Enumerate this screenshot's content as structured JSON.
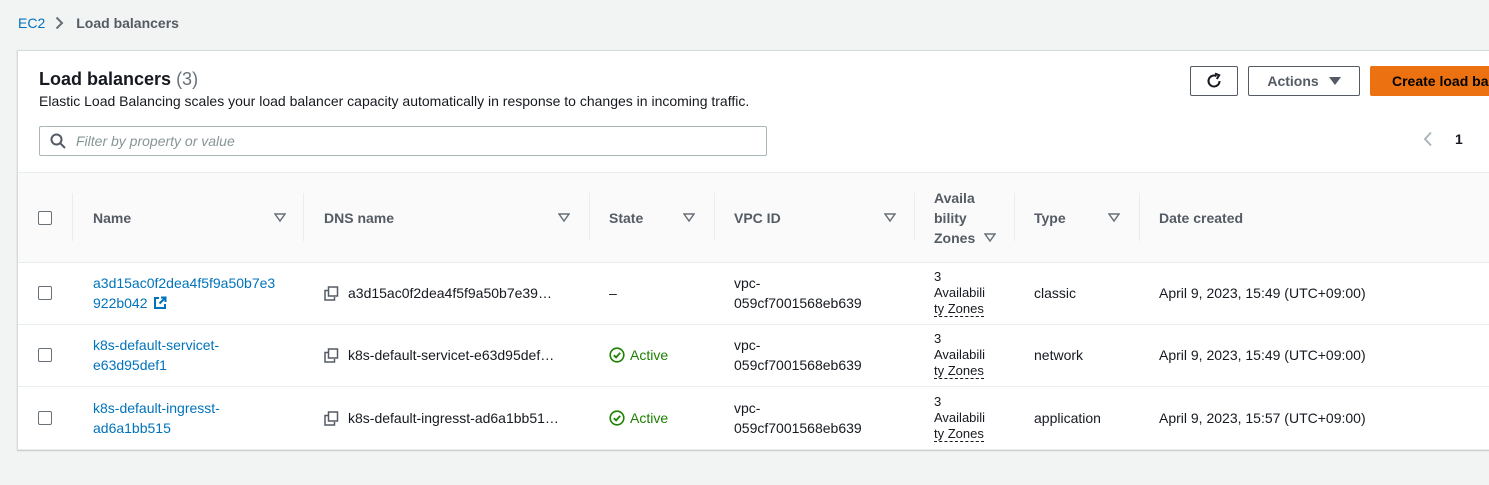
{
  "breadcrumb": {
    "root": "EC2",
    "current": "Load balancers"
  },
  "panel": {
    "title": "Load balancers",
    "count": "(3)",
    "description": "Elastic Load Balancing scales your load balancer capacity automatically in response to changes in incoming traffic.",
    "actions_label": "Actions",
    "create_label": "Create load ba",
    "filter_placeholder": "Filter by property or value",
    "page": "1"
  },
  "columns": {
    "name": "Name",
    "dns": "DNS name",
    "state": "State",
    "vpc": "VPC ID",
    "az1": "Availa",
    "az2": "bility",
    "az3": "Zones",
    "type": "Type",
    "date": "Date created"
  },
  "rows": [
    {
      "name1": "a3d15ac0f2dea4f5f9a50b7e3",
      "name2": "922b042",
      "dns": "a3d15ac0f2dea4f5f9a50b7e39…",
      "state": "–",
      "vpc1": "vpc-",
      "vpc2": "059cf7001568eb639",
      "az1": "3",
      "az2": "Availabili",
      "az3": "ty Zones",
      "type": "classic",
      "date": "April 9, 2023, 15:49 (UTC+09:00)"
    },
    {
      "name1": "k8s-default-servicet-",
      "name2": "e63d95def1",
      "dns": "k8s-default-servicet-e63d95def…",
      "state": "Active",
      "vpc1": "vpc-",
      "vpc2": "059cf7001568eb639",
      "az1": "3",
      "az2": "Availabili",
      "az3": "ty Zones",
      "type": "network",
      "date": "April 9, 2023, 15:49 (UTC+09:00)"
    },
    {
      "name1": "k8s-default-ingresst-",
      "name2": "ad6a1bb515",
      "dns": "k8s-default-ingresst-ad6a1bb51…",
      "state": "Active",
      "vpc1": "vpc-",
      "vpc2": "059cf7001568eb639",
      "az1": "3",
      "az2": "Availabili",
      "az3": "ty Zones",
      "type": "application",
      "date": "April 9, 2023, 15:57 (UTC+09:00)"
    }
  ],
  "colors": {
    "link": "#0073bb",
    "primary": "#ec7211",
    "success": "#1d8102"
  }
}
